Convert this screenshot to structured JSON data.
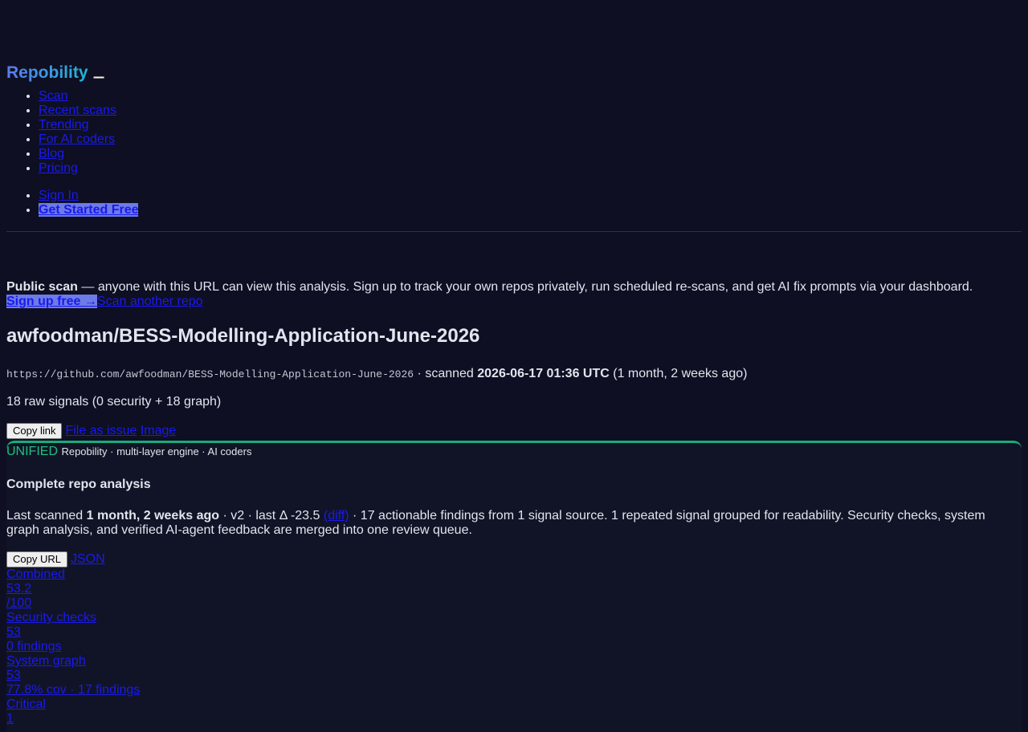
{
  "header": {
    "brand": "Repobility",
    "nav": [
      "Scan",
      "Recent scans",
      "Trending",
      "For AI coders",
      "Blog",
      "Pricing"
    ],
    "sign_in": "Sign In",
    "get_started": "Get Started Free"
  },
  "notice": {
    "bold": "Public scan",
    "text": " — anyone with this URL can view this analysis. Sign up to track your own repos privately, run scheduled re-scans, and get AI fix prompts via your dashboard.",
    "signup": "Sign up free →",
    "scan_another": "Scan another repo"
  },
  "repo": {
    "title": "awfoodman/BESS-Modelling-Application-June-2026",
    "url": "https://github.com/awfoodman/BESS-Modelling-Application-June-2026",
    "scanned_prefix": " · scanned ",
    "scanned_time": "2026-06-17 01:36 UTC",
    "scanned_ago": " (1 month, 2 weeks ago)",
    "signals": "18 raw signals (0 security + 18 graph)",
    "copy_link": "Copy link",
    "file_issue": "File as issue",
    "image": "Image"
  },
  "card": {
    "unified": "UNIFIED",
    "engine": "Repobility · multi-layer engine · AI coders",
    "title": "Complete repo analysis",
    "summary_prefix": "Last scanned ",
    "summary_bold": "1 month, 2 weeks ago",
    "summary_mid": " · v2 · last Δ -23.5 ",
    "diff": "(diff)",
    "summary_rest": " · 17 actionable findings from 1 signal source. 1 repeated signal grouped for readability. Security checks, system graph analysis, and verified AI-agent feedback are merged into one review queue.",
    "copy_url": "Copy URL",
    "json": "JSON",
    "stats": [
      "Combined",
      "53.2",
      "/100",
      "Security checks",
      "53",
      "0 findings",
      "System graph",
      "53",
      "77.8% cov · 17 findings",
      "Critical",
      "1"
    ]
  }
}
